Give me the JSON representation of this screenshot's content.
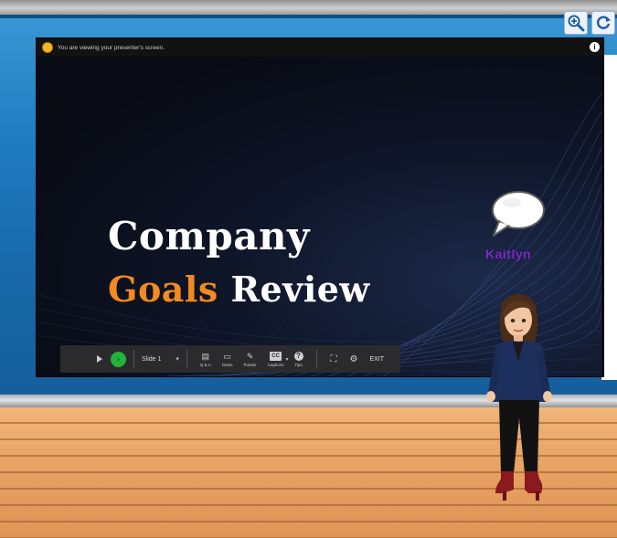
{
  "controls": {
    "zoom_icon": "zoom-in-icon",
    "refresh_icon": "refresh-icon"
  },
  "banner": {
    "text": "You are viewing your presenter's screen.",
    "info_glyph": "i"
  },
  "slide": {
    "title_line1": "Company",
    "title_accent": "Goals",
    "title_rest": " Review",
    "accent_color": "#f08a21"
  },
  "toolbar": {
    "slide_label": "Slide 1",
    "caret": "▾",
    "items": [
      {
        "glyph": "▤",
        "label": "Q & A"
      },
      {
        "glyph": "▭",
        "label": "Notes"
      },
      {
        "glyph": "✎",
        "label": "Pointer"
      },
      {
        "glyph": "CC",
        "label": "Captions"
      },
      {
        "glyph": "?",
        "label": "Tips"
      }
    ],
    "captions_caret": "▾",
    "exit_label": "EXIT",
    "go_color": "#22b33a"
  },
  "participant": {
    "name": "Kaitlyn",
    "name_color": "#7b2bc2"
  }
}
